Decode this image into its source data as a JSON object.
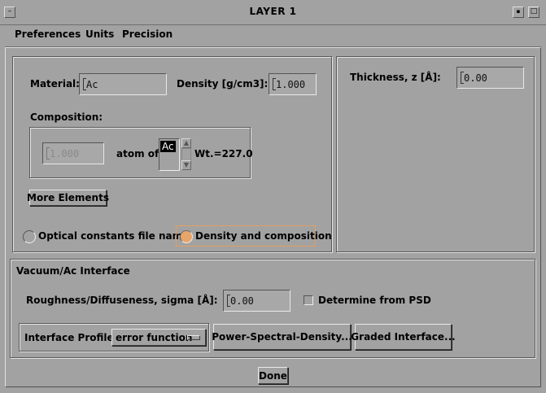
{
  "window": {
    "title": "LAYER 1",
    "menu_icon": "window-menu-icon",
    "minimize_icon": "minimize-icon",
    "maximize_icon": "maximize-icon"
  },
  "menubar": {
    "items": [
      "Preferences",
      "Units",
      "Precision"
    ]
  },
  "material": {
    "material_label": "Material:",
    "material_value": "Ac",
    "density_label": "Density [g/cm3]:",
    "density_value": "1.000",
    "composition_label": "Composition:",
    "atoms_value": "1.000",
    "atom_of_label": "atom of",
    "element_selected": "Ac",
    "weight_label": "Wt.=227.0",
    "more_elements_label": "More Elements",
    "radio_optical_label": "Optical constants file name",
    "radio_density_label": "Density and composition",
    "selected_mode": "Density and composition"
  },
  "thickness": {
    "label": "Thickness, z [Å]:",
    "value": "0.00"
  },
  "interface": {
    "title": "Vacuum/Ac Interface",
    "roughness_label": "Roughness/Diffuseness, sigma [Å]:",
    "roughness_value": "0.00",
    "psd_checkbox_label": "Determine from PSD",
    "psd_checked": false,
    "profile_label": "Interface Profile:",
    "profile_value": "error function",
    "psd_button_label": "Power-Spectral-Density...",
    "graded_button_label": "Graded Interface..."
  },
  "footer": {
    "done_label": "Done"
  },
  "colors": {
    "background": "#a2a2a2",
    "radio_selected": "#e8a56a",
    "focus_ring": "#e0a060"
  }
}
